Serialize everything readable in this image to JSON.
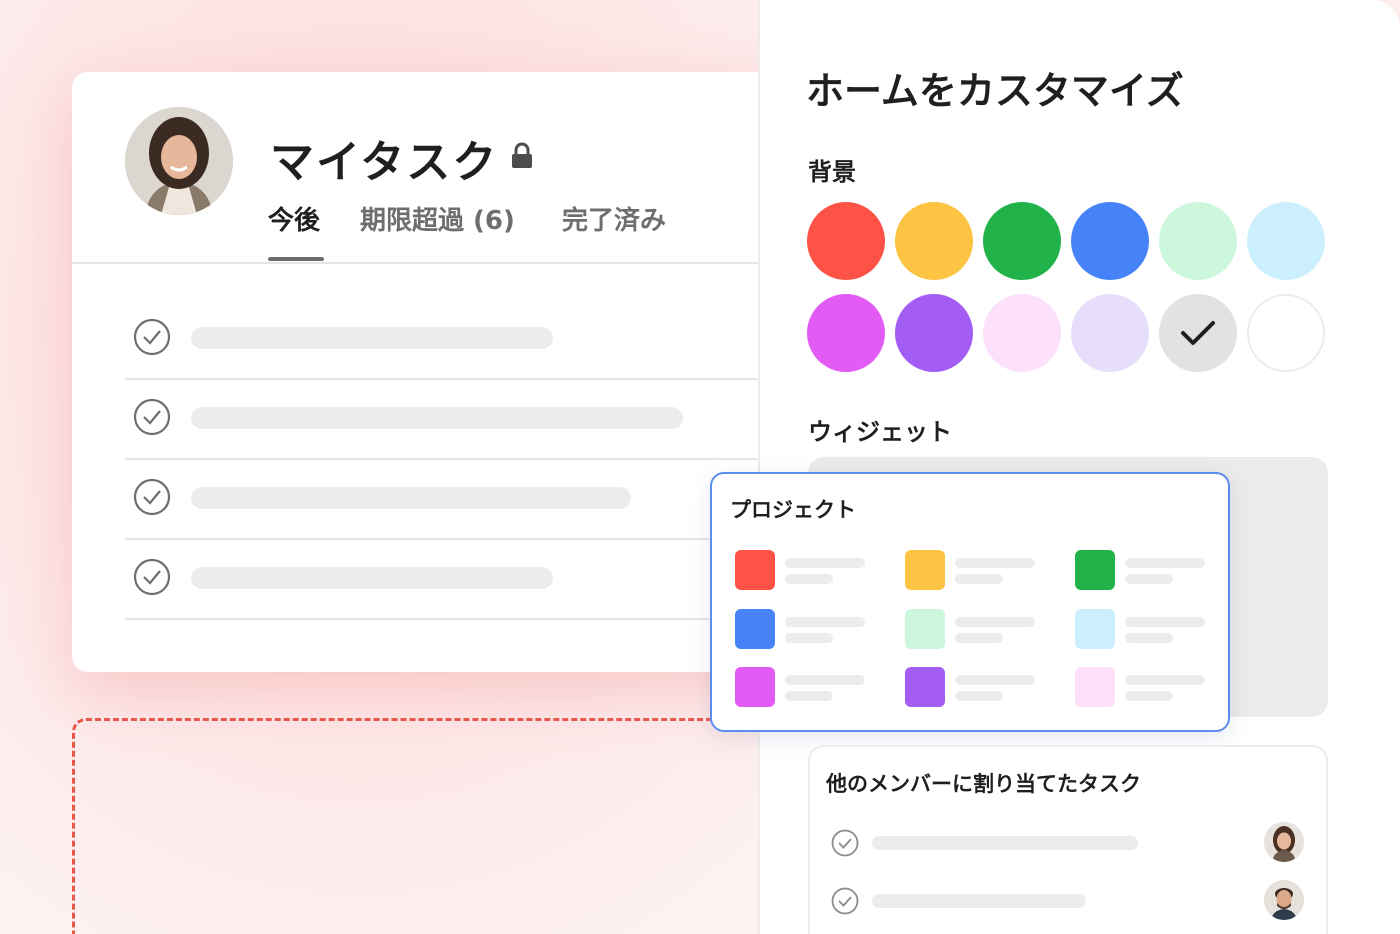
{
  "colors": {
    "red": "#fd5346",
    "yellow": "#fdc343",
    "green": "#21b24a",
    "blue": "#4683f8",
    "mint": "#ccf7dc",
    "sky": "#cceffd",
    "magenta": "#e35bf5",
    "purple": "#a35df4",
    "pink": "#fde0fb",
    "lavender": "#e6defb",
    "gray": "#e2e2e1",
    "white": "#ffffff",
    "accent_border": "#5b8def",
    "dashed": "#e8574a"
  },
  "my_tasks": {
    "title": "マイタスク",
    "lock_icon": "lock-icon",
    "tabs": [
      {
        "label": "今後",
        "active": true
      },
      {
        "label": "期限超過 (6)",
        "active": false
      },
      {
        "label": "完了済み",
        "active": false
      }
    ],
    "task_count": 4
  },
  "customize": {
    "title": "ホームをカスタマイズ",
    "background_label": "背景",
    "background_swatches": [
      "red",
      "yellow",
      "green",
      "blue",
      "mint",
      "sky",
      "magenta",
      "purple",
      "pink",
      "lavender",
      "gray",
      "white"
    ],
    "selected_swatch": "gray",
    "widgets_label": "ウィジェット"
  },
  "projects_widget": {
    "title": "プロジェクト",
    "project_colors": [
      "red",
      "yellow",
      "green",
      "blue",
      "mint",
      "sky",
      "magenta",
      "purple",
      "pink"
    ]
  },
  "others_widget": {
    "title": "他のメンバーに割り当てたタスク",
    "task_count": 2
  }
}
